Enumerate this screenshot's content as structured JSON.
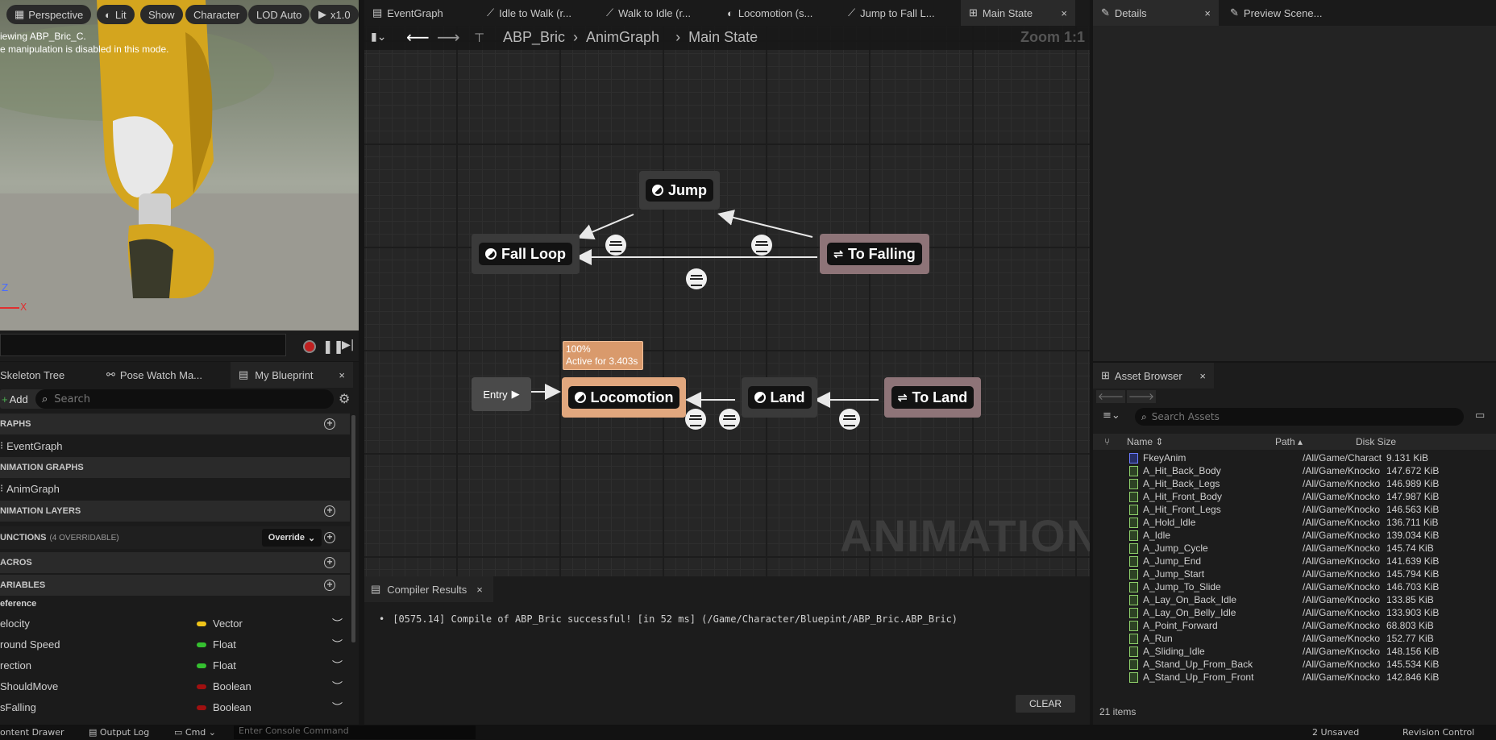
{
  "viewport": {
    "buttons": {
      "perspective": "Perspective",
      "lit": "Lit",
      "show": "Show",
      "character": "Character",
      "lod": "LOD Auto",
      "speed": "x1.0"
    },
    "info_line1": "iewing ABP_Bric_C.",
    "info_line2": "e manipulation is disabled in this mode.",
    "axis_z": "Z",
    "axis_x": "X"
  },
  "left_tabs": {
    "skeleton": "Skeleton Tree",
    "pose": "Pose Watch Ma...",
    "blueprint": "My Blueprint",
    "close": "×"
  },
  "left_toolbar": {
    "add": "Add",
    "search_placeholder": "Search"
  },
  "sections": {
    "graphs": "RAPHS",
    "eventgraph": "EventGraph",
    "anim_graphs": "NIMATION GRAPHS",
    "animgraph": "AnimGraph",
    "anim_layers": "NIMATION LAYERS",
    "functions": "UNCTIONS",
    "functions_note": "(4 OVERRIDABLE)",
    "override": "Override",
    "macros": "ACROS",
    "variables": "ARIABLES",
    "reference": "eference"
  },
  "variables": [
    {
      "name": "elocity",
      "type": "Vector",
      "color": "#f0c419"
    },
    {
      "name": "round Speed",
      "type": "Float",
      "color": "#35c030"
    },
    {
      "name": "rection",
      "type": "Float",
      "color": "#35c030"
    },
    {
      "name": "ShouldMove",
      "type": "Boolean",
      "color": "#a01010"
    },
    {
      "name": "sFalling",
      "type": "Boolean",
      "color": "#a01010"
    }
  ],
  "graph_tabs": [
    "EventGraph",
    "Idle to Walk (r...",
    "Walk to Idle (r...",
    "Locomotion (s...",
    "Jump to Fall L...",
    "Main State"
  ],
  "graph_tab_close": "×",
  "breadcrumb": {
    "bp": "ABP_Bric",
    "anim": "AnimGraph",
    "state": "Main State",
    "zoom": "Zoom 1:1"
  },
  "nodes": {
    "jump": "Jump",
    "fall_loop": "Fall Loop",
    "to_falling": "To Falling",
    "entry": "Entry",
    "locomotion": "Locomotion",
    "land": "Land",
    "to_land": "To Land"
  },
  "tooltip": {
    "pct": "100%",
    "active": "Active for 3.403s"
  },
  "watermark": "ANIMATION",
  "compiler": {
    "tab": "Compiler Results",
    "close": "×",
    "message": "[0575.14] Compile of ABP_Bric successful! [in 52 ms] (/Game/Character/Bluepint/ABP_Bric.ABP_Bric)",
    "clear": "CLEAR"
  },
  "details_tabs": {
    "details": "Details",
    "preview": "Preview Scene...",
    "close": "×"
  },
  "asset_browser": {
    "tab": "Asset Browser",
    "close": "×",
    "search_placeholder": "Search Assets",
    "col_name": "Name",
    "col_path": "Path",
    "col_size": "Disk Size",
    "items": [
      {
        "name": "FkeyAnim",
        "path": "/All/Game/Charact",
        "size": "9.131 KiB"
      },
      {
        "name": "A_Hit_Back_Body",
        "path": "/All/Game/Knocko",
        "size": "147.672 KiB"
      },
      {
        "name": "A_Hit_Back_Legs",
        "path": "/All/Game/Knocko",
        "size": "146.989 KiB"
      },
      {
        "name": "A_Hit_Front_Body",
        "path": "/All/Game/Knocko",
        "size": "147.987 KiB"
      },
      {
        "name": "A_Hit_Front_Legs",
        "path": "/All/Game/Knocko",
        "size": "146.563 KiB"
      },
      {
        "name": "A_Hold_Idle",
        "path": "/All/Game/Knocko",
        "size": "136.711 KiB"
      },
      {
        "name": "A_Idle",
        "path": "/All/Game/Knocko",
        "size": "139.034 KiB"
      },
      {
        "name": "A_Jump_Cycle",
        "path": "/All/Game/Knocko",
        "size": "145.74 KiB"
      },
      {
        "name": "A_Jump_End",
        "path": "/All/Game/Knocko",
        "size": "141.639 KiB"
      },
      {
        "name": "A_Jump_Start",
        "path": "/All/Game/Knocko",
        "size": "145.794 KiB"
      },
      {
        "name": "A_Jump_To_Slide",
        "path": "/All/Game/Knocko",
        "size": "146.703 KiB"
      },
      {
        "name": "A_Lay_On_Back_Idle",
        "path": "/All/Game/Knocko",
        "size": "133.85 KiB"
      },
      {
        "name": "A_Lay_On_Belly_Idle",
        "path": "/All/Game/Knocko",
        "size": "133.903 KiB"
      },
      {
        "name": "A_Point_Forward",
        "path": "/All/Game/Knocko",
        "size": "68.803 KiB"
      },
      {
        "name": "A_Run",
        "path": "/All/Game/Knocko",
        "size": "152.77 KiB"
      },
      {
        "name": "A_Sliding_Idle",
        "path": "/All/Game/Knocko",
        "size": "148.156 KiB"
      },
      {
        "name": "A_Stand_Up_From_Back",
        "path": "/All/Game/Knocko",
        "size": "145.534 KiB"
      },
      {
        "name": "A_Stand_Up_From_Front",
        "path": "/All/Game/Knocko",
        "size": "142.846 KiB"
      }
    ],
    "count": "21 items"
  },
  "status": {
    "content_drawer": "ontent Drawer",
    "output_log": "Output Log",
    "cmd": "Cmd",
    "console_placeholder": "Enter Console Command",
    "unsaved": "2 Unsaved",
    "revision": "Revision Control"
  }
}
